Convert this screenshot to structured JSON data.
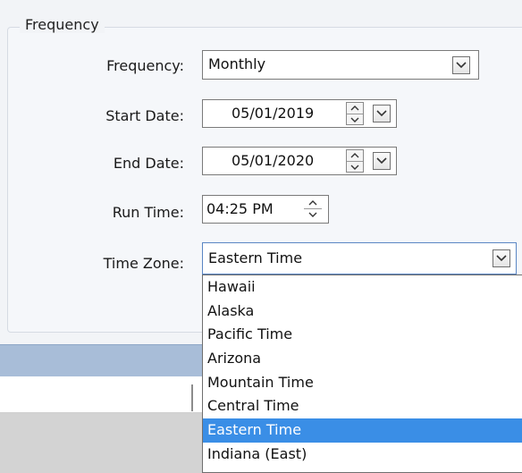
{
  "frequency_group": {
    "legend": "Frequency",
    "frequency": {
      "label": "Frequency:",
      "value": "Monthly"
    },
    "start_date": {
      "label": "Start Date:",
      "value": "05/01/2019"
    },
    "end_date": {
      "label": "End Date:",
      "value": "05/01/2020"
    },
    "run_time": {
      "label": "Run Time:",
      "value": "04:25 PM"
    },
    "time_zone": {
      "label": "Time Zone:",
      "value": "Eastern Time",
      "options": [
        "Hawaii",
        "Alaska",
        "Pacific Time",
        "Arizona",
        "Mountain Time",
        "Central Time",
        "Eastern Time",
        "Indiana (East)"
      ],
      "highlighted": "Eastern Time"
    }
  },
  "colors": {
    "highlight": "#3a8ee6",
    "toolbar": "#a8bdd8",
    "footer": "#d3d3d3"
  },
  "icons": [
    "chevron-down-icon",
    "spin-up-icon",
    "spin-down-icon"
  ]
}
